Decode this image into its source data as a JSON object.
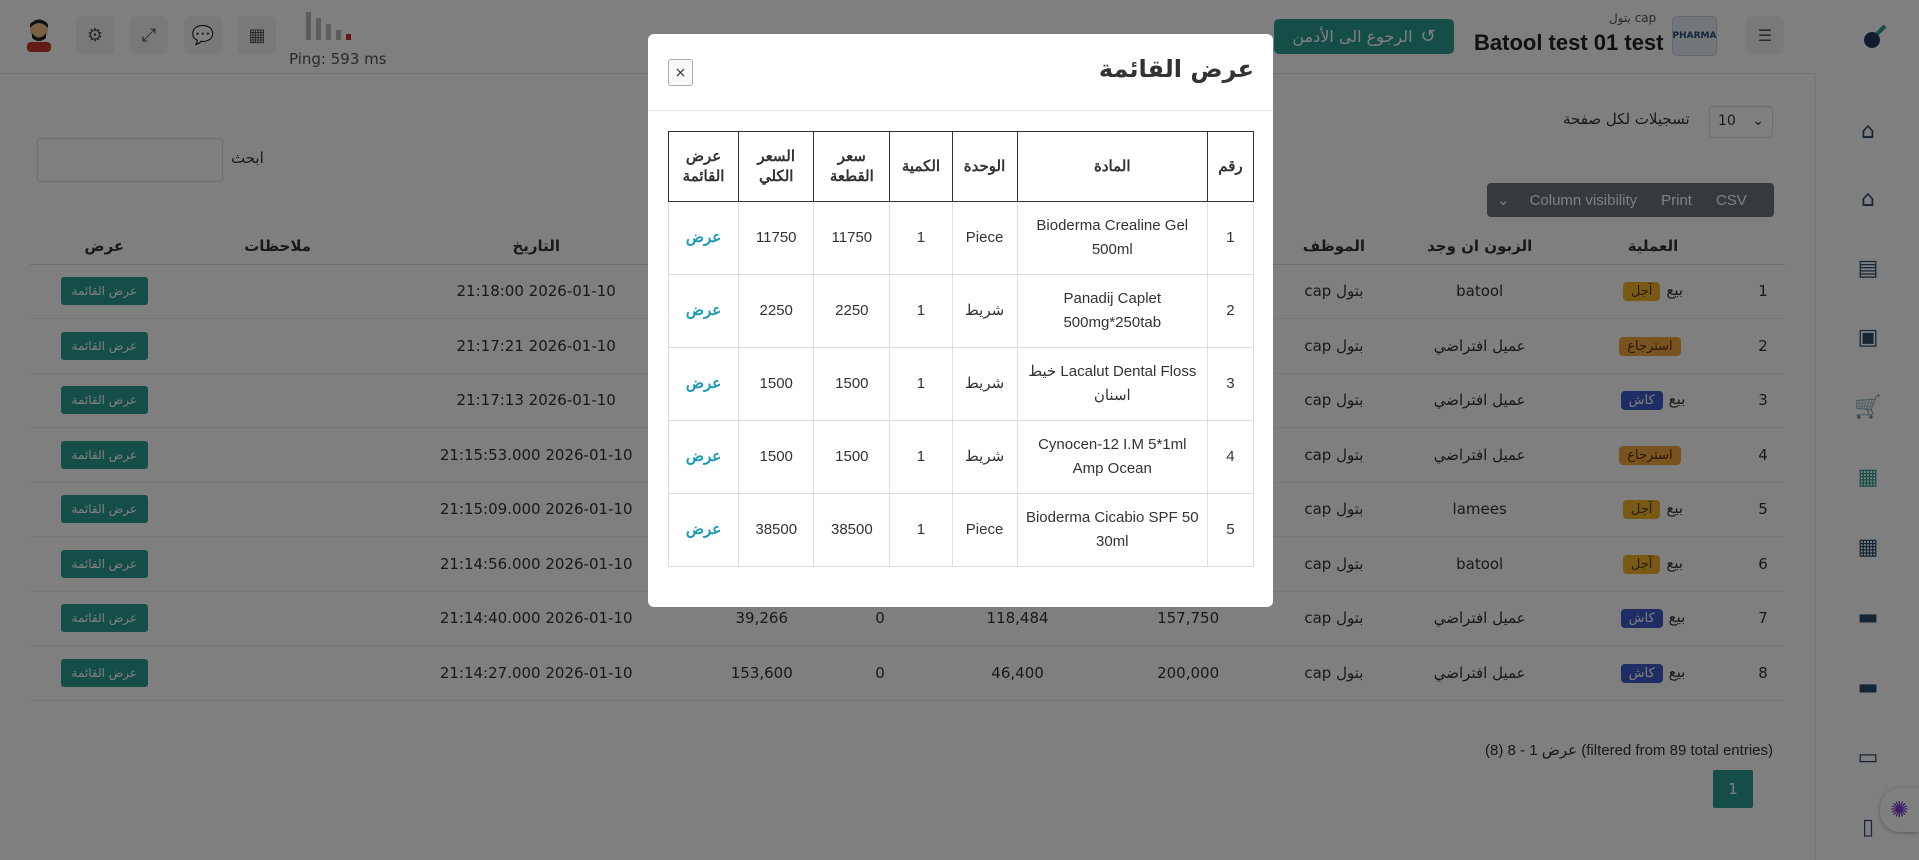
{
  "topbar": {
    "ping": "Ping: 593 ms",
    "admin_button": "الرجوع الى الأدمن",
    "user_name": "Batool test 01 test",
    "user_sub": "بتول cap",
    "logo_text": "PHARMA"
  },
  "sidebar": {
    "icons": [
      "home-icon",
      "home-icon",
      "clipboard-icon",
      "box-icon",
      "cart-icon",
      "cash-register-icon",
      "cash-register-icon",
      "wallet-icon",
      "wallet-icon",
      "scroll-icon",
      "book-icon"
    ]
  },
  "listing": {
    "length_label": "تسجيلات لكل صفحة",
    "length_value": "10",
    "search_label": "ابحث",
    "buttons": {
      "csv": "CSV",
      "print": "Print",
      "visibility": "Column visibility"
    },
    "headers": {
      "num": "",
      "op": "العملية",
      "customer": "الزبون ان وجد",
      "employee": "الموظف",
      "date": "التاريخ",
      "notes": "ملاحظات",
      "view": "عرض"
    },
    "view_label": "عرض القائمة",
    "rows": [
      {
        "num": "1",
        "op": "بيع",
        "badge": "آجل",
        "badge_type": "b-yellow",
        "customer": "batool",
        "employee": "بتول cap",
        "total": "",
        "qty": "",
        "disc": "",
        "net": "",
        "date": "2026-01-10 21:18:00"
      },
      {
        "num": "2",
        "op": "",
        "badge": "استرجاع",
        "badge_type": "b-orange",
        "customer": "عميل افتراضي",
        "employee": "بتول cap",
        "total": "",
        "qty": "",
        "disc": "",
        "net": "",
        "date": "2026-01-10 21:17:21"
      },
      {
        "num": "3",
        "op": "بيع",
        "badge": "كاش",
        "badge_type": "b-blue",
        "customer": "عميل افتراضي",
        "employee": "بتول cap",
        "total": "",
        "qty": "",
        "disc": "",
        "net": "",
        "date": "2026-01-10 21:17:13"
      },
      {
        "num": "4",
        "op": "",
        "badge": "استرجاع",
        "badge_type": "b-orange",
        "customer": "عميل افتراضي",
        "employee": "بتول cap",
        "total": "",
        "qty": "",
        "disc": "",
        "net": "",
        "date": "2026-01-10 21:15:53.000"
      },
      {
        "num": "5",
        "op": "بيع",
        "badge": "آجل",
        "badge_type": "b-yellow",
        "customer": "lamees",
        "employee": "بتول cap",
        "total": "",
        "qty": "",
        "disc": "",
        "net": "",
        "date": "2026-01-10 21:15:09.000"
      },
      {
        "num": "6",
        "op": "بيع",
        "badge": "آجل",
        "badge_type": "b-yellow",
        "customer": "batool",
        "employee": "بتول cap",
        "total": "",
        "qty": "",
        "disc": "",
        "net": "",
        "date": "2026-01-10 21:14:56.000"
      },
      {
        "num": "7",
        "op": "بيع",
        "badge": "كاش",
        "badge_type": "b-blue",
        "customer": "عميل افتراضي",
        "employee": "بتول cap",
        "total": "157,750",
        "qty": "0",
        "disc": "118,484",
        "net": "39,266",
        "date": "2026-01-10 21:14:40.000"
      },
      {
        "num": "8",
        "op": "بيع",
        "badge": "كاش",
        "badge_type": "b-blue",
        "customer": "عميل افتراضي",
        "employee": "بتول cap",
        "total": "200,000",
        "qty": "0",
        "disc": "46,400",
        "net": "153,600",
        "date": "2026-01-10 21:14:27.000"
      }
    ],
    "info": "عرض 1 - 8 (8) (filtered from 89 total entries)",
    "page": "1"
  },
  "modal": {
    "title": "عرض القائمة",
    "close_label": "×",
    "headers": {
      "num": "رقم",
      "item": "المادة",
      "unit": "الوحدة",
      "qty": "الكمية",
      "unit_price": "سعر القطعة",
      "total_price": "السعر الكلي",
      "view": "عرض القائمة"
    },
    "view_label": "عرض",
    "rows": [
      {
        "num": "1",
        "item": "Bioderma Crealine Gel 500ml",
        "unit": "Piece",
        "qty": "1",
        "unit_price": "11750",
        "total_price": "11750"
      },
      {
        "num": "2",
        "item": "Panadij Caplet 500mg*250tab",
        "unit": "شريط",
        "qty": "1",
        "unit_price": "2250",
        "total_price": "2250"
      },
      {
        "num": "3",
        "item": "Lacalut Dental Floss خيط اسنان",
        "unit": "شريط",
        "qty": "1",
        "unit_price": "1500",
        "total_price": "1500"
      },
      {
        "num": "4",
        "item": "Cynocen-12 I.M 5*1ml Amp Ocean",
        "unit": "شريط",
        "qty": "1",
        "unit_price": "1500",
        "total_price": "1500"
      },
      {
        "num": "5",
        "item": "Bioderma Cicabio SPF 50 30ml",
        "unit": "Piece",
        "qty": "1",
        "unit_price": "38500",
        "total_price": "38500"
      }
    ]
  }
}
